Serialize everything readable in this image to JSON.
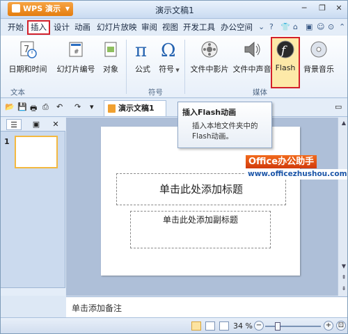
{
  "app": {
    "menu_button": "WPS 演示",
    "window_title": "演示文稿1"
  },
  "menubar": {
    "items": [
      "开始",
      "插入",
      "设计",
      "动画",
      "幻灯片放映",
      "审阅",
      "视图",
      "开发工具",
      "办公空间"
    ],
    "active_index": 1
  },
  "ribbon": {
    "buttons": [
      {
        "label": "日期和时间",
        "icon": "calendar-clock-icon"
      },
      {
        "label": "幻灯片编号",
        "icon": "slide-number-icon"
      },
      {
        "label": "对象",
        "icon": "object-icon"
      },
      {
        "label": "公式",
        "icon": "pi-icon"
      },
      {
        "label": "符号",
        "icon": "omega-icon"
      },
      {
        "label": "文件中影片",
        "icon": "film-icon"
      },
      {
        "label": "文件中声音",
        "icon": "speaker-icon"
      },
      {
        "label": "Flash",
        "icon": "flash-icon"
      },
      {
        "label": "背景音乐",
        "icon": "cd-music-icon"
      }
    ],
    "groups": {
      "text": "文本",
      "symbol": "符号",
      "media": "媒体"
    }
  },
  "quick_access": {
    "doc_tab": "演示文稿1"
  },
  "tooltip": {
    "title": "插入Flash动画",
    "body": "插入本地文件夹中的Flash动画。"
  },
  "slides_pane": {
    "slide_number": "1"
  },
  "slide": {
    "title_placeholder": "单击此处添加标题",
    "subtitle_placeholder": "单击此处添加副标题"
  },
  "notes": {
    "placeholder": "单击添加备注"
  },
  "status": {
    "zoom": "34 %"
  },
  "watermark": {
    "line1": "Office办公助手",
    "line2": "www.officezhushou.com"
  },
  "colors": {
    "accent": "#e47d0f",
    "highlight_border": "#d3202a"
  }
}
